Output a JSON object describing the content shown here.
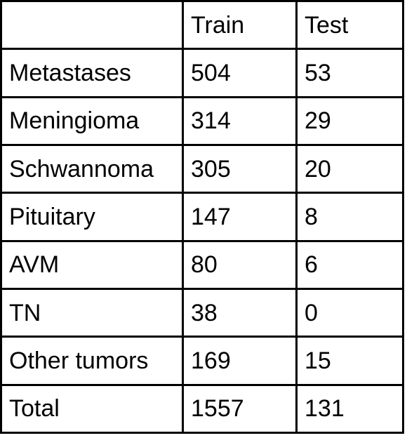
{
  "table": {
    "columns": [
      {
        "key": "label",
        "header": ""
      },
      {
        "key": "train",
        "header": "Train"
      },
      {
        "key": "test",
        "header": "Test"
      }
    ],
    "corner_label": "",
    "header_train": "Train",
    "header_test": "Test",
    "rows": [
      {
        "label": "Metastases",
        "train": "504",
        "test": "53"
      },
      {
        "label": "Meningioma",
        "train": "314",
        "test": "29"
      },
      {
        "label": "Schwannoma",
        "train": "305",
        "test": "20"
      },
      {
        "label": "Pituitary",
        "train": "147",
        "test": "8"
      },
      {
        "label": "AVM",
        "train": "80",
        "test": "6"
      },
      {
        "label": "TN",
        "train": "38",
        "test": "0"
      },
      {
        "label": "Other tumors",
        "train": "169",
        "test": "15"
      },
      {
        "label": "Total",
        "train": "1557",
        "test": "131"
      }
    ]
  },
  "style": {
    "border_color": "#000000",
    "text_color": "#000000",
    "background_color": "#ffffff"
  },
  "chart_data": {
    "type": "table",
    "title": "",
    "categories": [
      "Metastases",
      "Meningioma",
      "Schwannoma",
      "Pituitary",
      "AVM",
      "TN",
      "Other tumors",
      "Total"
    ],
    "series": [
      {
        "name": "Train",
        "values": [
          504,
          314,
          305,
          147,
          80,
          38,
          169,
          1557
        ]
      },
      {
        "name": "Test",
        "values": [
          53,
          29,
          20,
          8,
          6,
          0,
          15,
          131
        ]
      }
    ],
    "columns": [
      "",
      "Train",
      "Test"
    ],
    "xlabel": "",
    "ylabel": ""
  }
}
